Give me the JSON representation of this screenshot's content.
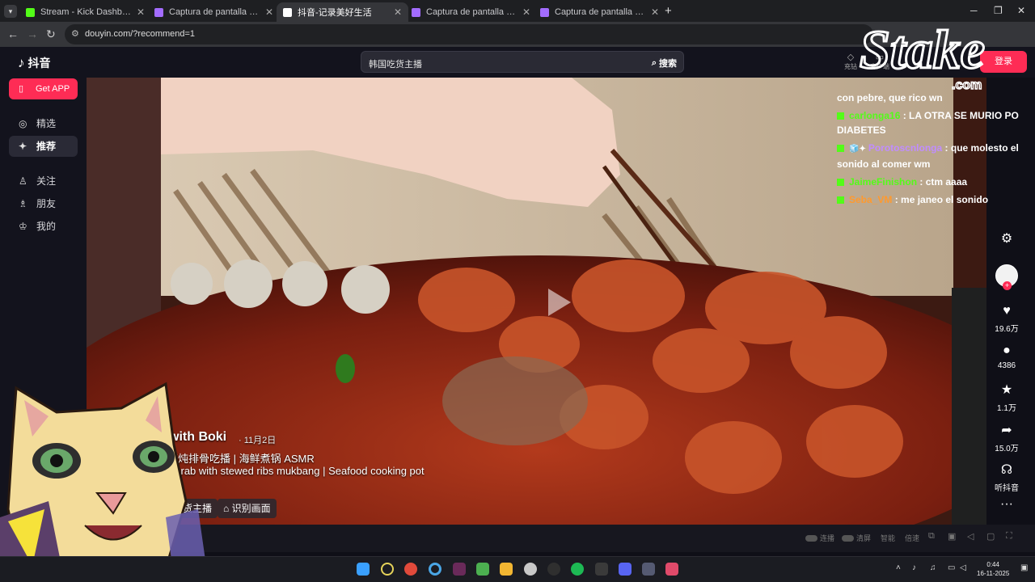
{
  "browser": {
    "tabs": [
      {
        "title": "Stream - Kick Dashboard",
        "favicon_color": "#53fc18",
        "active": false
      },
      {
        "title": "Captura de pantalla por Lightshot",
        "favicon_color": "#a36cff",
        "active": false
      },
      {
        "title": "抖音-记录美好生活",
        "favicon_color": "#ffffff",
        "active": true
      },
      {
        "title": "Captura de pantalla por Lightshot",
        "favicon_color": "#a36cff",
        "active": false
      },
      {
        "title": "Captura de pantalla por Lightshot",
        "favicon_color": "#a36cff",
        "active": false
      }
    ],
    "url": "douyin.com/?recommend=1"
  },
  "header": {
    "logo_text": "抖音",
    "search_query": "韩国吃货主播",
    "search_button": "搜索",
    "icon_labels": [
      "充钻",
      "客户端"
    ],
    "login_label": "登录"
  },
  "sidebar": {
    "get_app": "Get APP",
    "items": [
      {
        "label": "精选",
        "icon": "compass-icon",
        "active": false
      },
      {
        "label": "推荐",
        "icon": "sparkle-icon",
        "active": true
      },
      {
        "label": "关注",
        "icon": "follow-icon",
        "active": false
      },
      {
        "label": "朋友",
        "icon": "friends-icon",
        "active": false
      },
      {
        "label": "我的",
        "icon": "profile-icon",
        "active": false
      }
    ]
  },
  "video": {
    "author": "with Boki",
    "date": "· 11月2日",
    "title_cn": "石炖排骨吃播 | 海鲜煮锅 ASMR",
    "title_en": "crab with stewed ribs mukbang | Seafood cooking pot",
    "tag": "吃货主播",
    "identify": "识别画面"
  },
  "actions": {
    "likes": "19.6万",
    "comments": "4386",
    "favorites": "1.1万",
    "shares": "15.0万",
    "listen": "听抖音"
  },
  "controls": {
    "autoplay": "连播",
    "clean": "清屏",
    "smart": "智能",
    "speed": "倍速"
  },
  "chat": [
    {
      "user": "",
      "message": "con pebre, que rico wn",
      "user_color": "#ffffff"
    },
    {
      "user": "carlonga16",
      "message": "LA OTRA SE MURIO PO DIABETES",
      "user_color": "#53fc18"
    },
    {
      "user": "Porotoscnlonga",
      "message": "que molesto el sonido al comer wm",
      "user_color": "#c08cff"
    },
    {
      "user": "JaimeFinishon",
      "message": "ctm aaaa",
      "user_color": "#53fc18"
    },
    {
      "user": "Seba_VM",
      "message": "me janeo el sonido",
      "user_color": "#ff9a2e"
    }
  ],
  "watermark": {
    "brand": "Stake",
    "tld": ".com"
  },
  "taskbar": {
    "time": "0:44",
    "date": "16-11-2025"
  }
}
